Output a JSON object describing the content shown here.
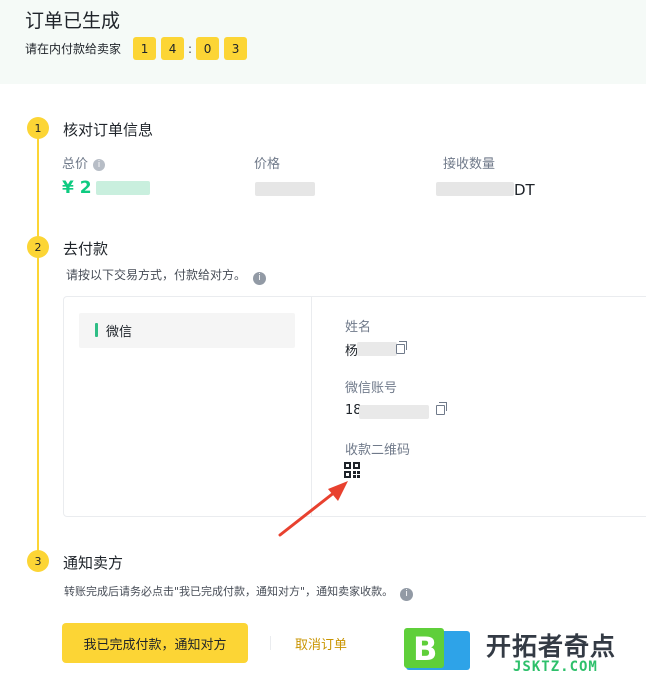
{
  "header": {
    "title": "订单已生成",
    "countdown_label": "请在内付款给卖家",
    "countdown": [
      "1",
      "4",
      "0",
      "3"
    ]
  },
  "step1": {
    "number": "1",
    "title": "核对订单信息",
    "total_label": "总价",
    "total_value": "¥ 2",
    "price_label": "价格",
    "quantity_label": "接收数量",
    "quantity_suffix": "DT"
  },
  "step2": {
    "number": "2",
    "title": "去付款",
    "hint": "请按以下交易方式，付款给对方。",
    "method": "微信",
    "name_label": "姓名",
    "name_value_prefix": "杨",
    "account_label": "微信账号",
    "account_value_prefix": "18",
    "qr_label": "收款二维码"
  },
  "step3": {
    "number": "3",
    "title": "通知卖方",
    "hint": "转账完成后请务必点击\"我已完成付款，通知对方\"，通知卖家收款。",
    "confirm_button": "我已完成付款，通知对方",
    "cancel_link": "取消订单"
  },
  "watermark": {
    "logo_letter": "B",
    "name": "开拓者奇点",
    "domain": "JSKTZ.COM"
  },
  "colors": {
    "accent": "#fcd535",
    "price_green": "#0ecb81",
    "cancel": "#c99400",
    "annotation_arrow": "#e8412f"
  }
}
